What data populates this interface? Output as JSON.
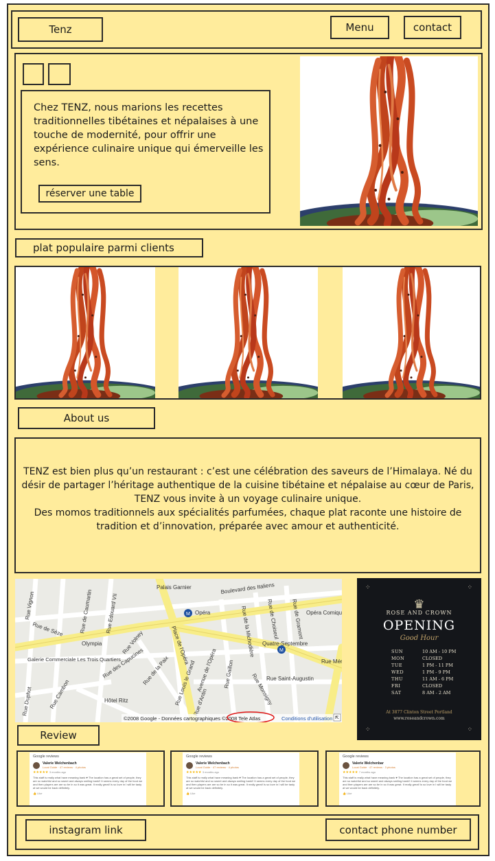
{
  "header": {
    "brand": "Tenz",
    "nav": [
      "Menu",
      "contact"
    ]
  },
  "hero": {
    "text": "Chez TENZ, nous marions les recettes traditionnelles tibétaines et népalaises à une touche de modernité, pour offrir une expérience culinaire unique qui émerveille les sens.",
    "cta": "réserver une table"
  },
  "popular": {
    "title": "plat populaire parmi clients"
  },
  "about": {
    "title": "About us",
    "p1": "TENZ est bien plus qu’un restaurant : c’est une célébration des saveurs de l’Himalaya. Né du désir de partager l’héritage authentique de la cuisine tibétaine et népalaise au cœur de Paris, TENZ vous invite à un voyage culinaire unique.",
    "p2": "Des momos traditionnels aux spécialités parfumées, chaque plat raconte une histoire de tradition et d’innovation, préparée avec amour et authenticité."
  },
  "map": {
    "labels": {
      "boulevard": "Boulevard des Italiens",
      "opera": "Opéra",
      "place_opera": "Place de l'Opéra",
      "opera_comique": "Opéra Comique",
      "rue_vignon": "Rue Vignon",
      "rue_caumartin": "Rue de Caumartin",
      "rue_seze": "Rue de Sèze",
      "olympia": "Olympia",
      "galerie": "Galerie Commerciale Les Trois Quartiers",
      "rue_cambon": "Rue Cambon",
      "rue_capucines": "Rue des Capucines",
      "rue_paix": "Rue de la Paix",
      "rue_volney": "Rue Volney",
      "hotel_ritz": "Hôtel Ritz",
      "rue_michodiere": "Rue de la Michodière",
      "rue_choiseul": "Rue de Choiseul",
      "rue_gramont": "Rue de Gramont",
      "quatre_septembre": "Quatre-Septembre",
      "rue_st_augustin": "Rue Saint-Augustin",
      "rue_menars": "Rue Ménars",
      "rue_gaillon": "Rue Gaillon",
      "rue_monsigny": "Rue Monsigny",
      "av_opera": "Avenue de l'Opéra",
      "rue_louis_grand": "Rue Louis le Grand",
      "rue_antin": "Rue d'Antin",
      "palais_garnier": "Palais Garnier",
      "rue_duphot": "Rue Duphot",
      "edouard": "Rue Edouard VII"
    },
    "credit": "©2008 Google - Données cartographiques ©2008 Tele Atlas",
    "terms": "Conditions d'utilisation"
  },
  "poster": {
    "brand": "ROSE AND CROWN",
    "title": "OPENING",
    "subtitle": "Good Hour",
    "hours": [
      [
        "SUN",
        "10 AM - 10 PM"
      ],
      [
        "MON",
        "CLOSED"
      ],
      [
        "TUE",
        "1 PM - 11 PM"
      ],
      [
        "WED",
        "1 PM - 9 PM"
      ],
      [
        "THU",
        "11 AM - 6 PM"
      ],
      [
        "FRI",
        "CLOSED"
      ],
      [
        "SAT",
        "8 AM - 2 AM"
      ]
    ],
    "address": "At 3877 Clinton Street Portland",
    "website": "www.roseandcrown.com"
  },
  "review": {
    "title": "Review",
    "cards": [
      {
        "source": "Google reviews",
        "name": "Valerie Welchenbach",
        "meta": "Local Guide · 47 reviews · 4 photos",
        "stars": "★★★★★",
        "ago": "3 months ago",
        "text": "This staff is really what have meaning bank ♥ The location has a great set of people, they are so watchful and so sweet and always smiling bank!! It seems every day of the food we and then players are are so be in so it was great. It really great! Is so love in I will be tasty at we would be back definitely.",
        "like": "Like"
      },
      {
        "source": "Google reviews",
        "name": "Valerie Welchenbach",
        "meta": "Local Guide · 47 reviews · 4 photos",
        "stars": "★★★★★",
        "ago": "3 months ago",
        "text": "This staff is really what have meaning bank ♥ The location has a great set of people, they are so watchful and so sweet and always smiling bank!! It seems every day of the food we and then players are are so be in so it was great. It really great! Is so love in I will be tasty at we would be back definitely.",
        "like": "Like"
      },
      {
        "source": "Google reviews",
        "name": "Valerie Welchenbar",
        "meta": "Local Guide · 47 reviews · 3 photos",
        "stars": "★★★★★",
        "ago": "7 months ago",
        "text": "This staff is really what have meaning bank ♥ The location has a great set of people, they are so watchful and so sweet and always smiling bank!! It seems every day of the food we and then players are are so be in so it was great. It really great! Is so love in I will be tasty at we would be back definitely.",
        "like": "Like"
      }
    ]
  },
  "footer": {
    "instagram": "instagram link",
    "phone": "contact phone number"
  }
}
